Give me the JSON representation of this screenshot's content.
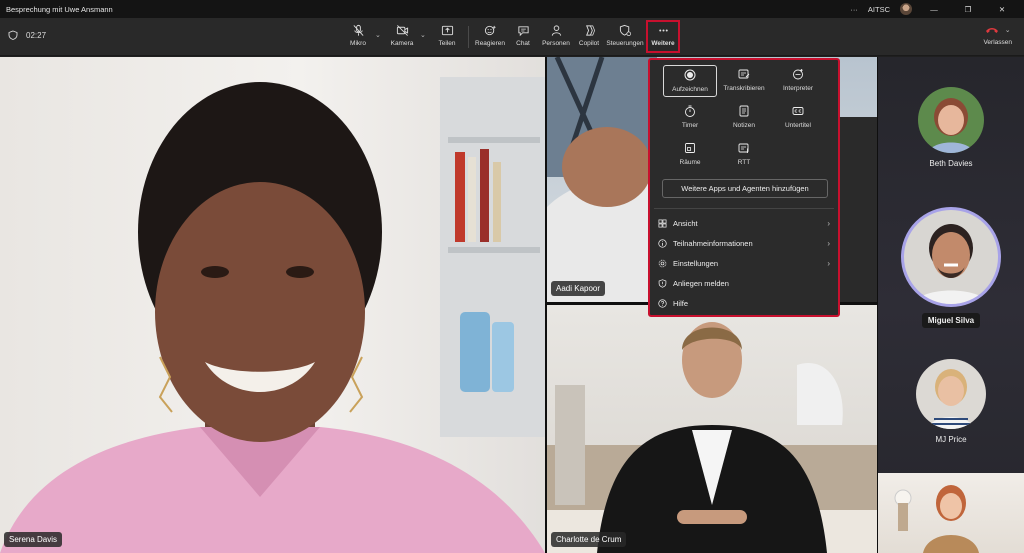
{
  "window": {
    "title": "Besprechung mit Uwe Ansmann",
    "more": "···",
    "org": "AITSC"
  },
  "meeting": {
    "elapsed": "02:27"
  },
  "toolbar": {
    "mic": "Mikro",
    "camera": "Kamera",
    "share": "Teilen",
    "react": "Reagieren",
    "chat": "Chat",
    "people": "Personen",
    "copilot": "Copilot",
    "controls": "Steuerungen",
    "more": "Weitere",
    "leave": "Verlassen"
  },
  "menu": {
    "grid": [
      "Aufzeichnen",
      "Transkribieren",
      "Interpreter",
      "Timer",
      "Notizen",
      "Untertitel",
      "Räume",
      "RTT"
    ],
    "add_apps": "Weitere Apps und Agenten hinzufügen",
    "view": "Ansicht",
    "info": "Teilnahmeinformationen",
    "settings": "Einstellungen",
    "report": "Anliegen melden",
    "help": "Hilfe"
  },
  "participants": {
    "main": "Serena Davis",
    "top_right": "Aadi Kapoor",
    "bottom_right": "Charlotte de Crum",
    "rail": [
      "Beth Davies",
      "Miguel Silva",
      "MJ Price"
    ]
  },
  "colors": {
    "highlight": "#c8102e",
    "leave": "#e0393e",
    "toolbar_bg": "#292929"
  }
}
